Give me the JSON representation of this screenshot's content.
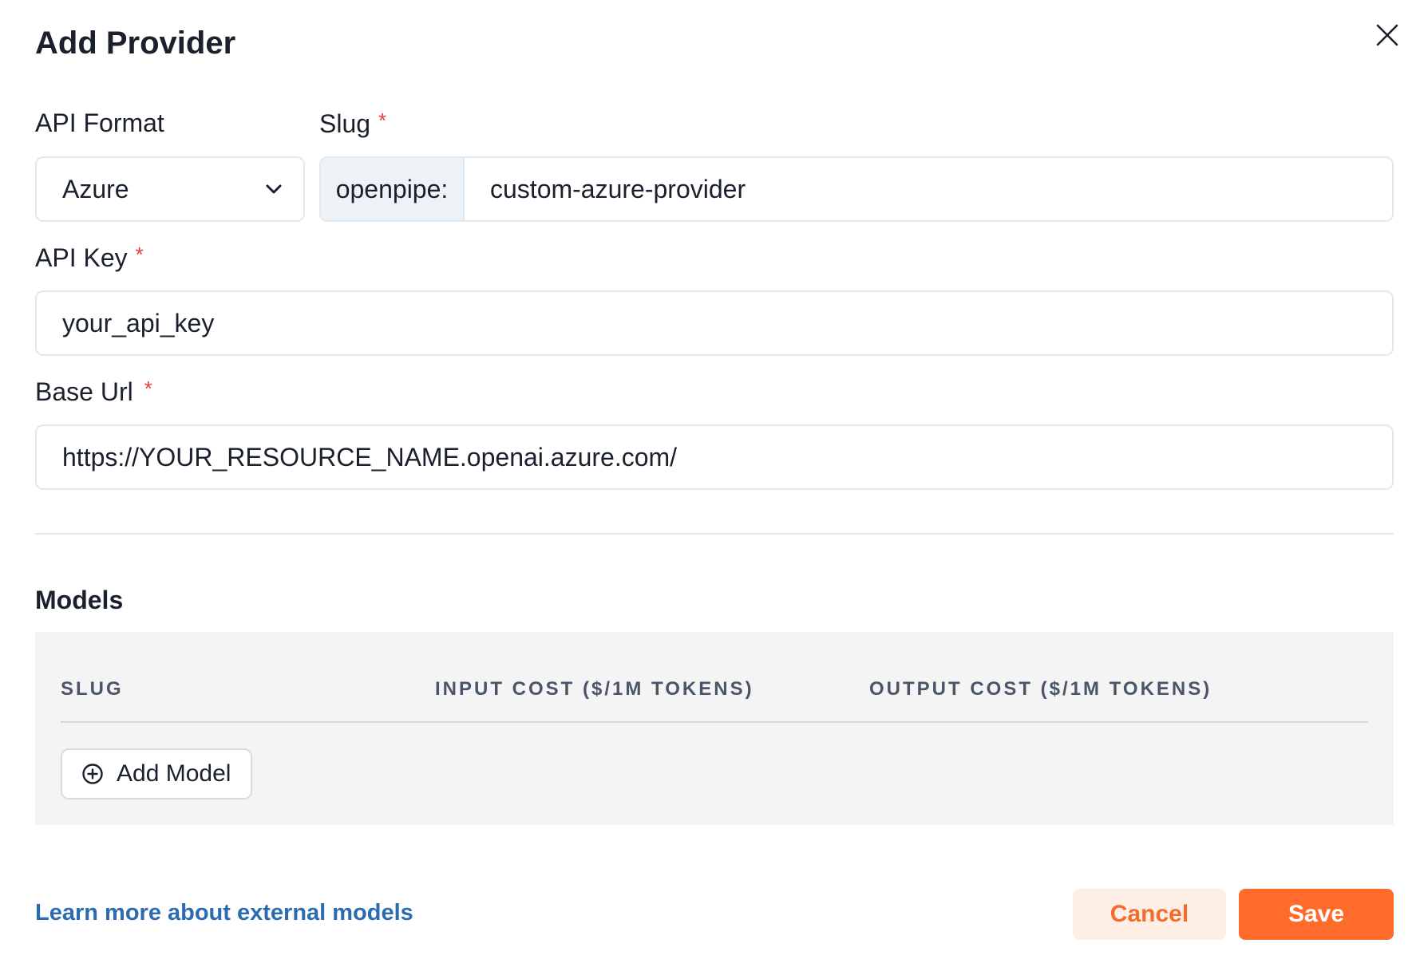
{
  "dialog": {
    "title": "Add Provider"
  },
  "form": {
    "api_format": {
      "label": "API Format",
      "value": "Azure"
    },
    "slug": {
      "label": "Slug",
      "required_mark": "*",
      "prefix": "openpipe:",
      "value": "custom-azure-provider"
    },
    "api_key": {
      "label": "API Key",
      "required_mark": "*",
      "value": "your_api_key"
    },
    "base_url": {
      "label": "Base Url",
      "required_mark": "*",
      "value": "https://YOUR_RESOURCE_NAME.openai.azure.com/"
    }
  },
  "models": {
    "heading": "Models",
    "columns": [
      "SLUG",
      "INPUT COST ($/1M TOKENS)",
      "OUTPUT COST ($/1M TOKENS)"
    ],
    "add_button_label": "Add Model"
  },
  "footer": {
    "learn_more_link": "Learn more about external models",
    "cancel_label": "Cancel",
    "save_label": "Save"
  },
  "colors": {
    "accent": "#ff6b2b",
    "link": "#2b6cb0",
    "required": "#e53e3e"
  },
  "icons": [
    "close-icon",
    "chevron-down-icon",
    "plus-circle-icon"
  ]
}
